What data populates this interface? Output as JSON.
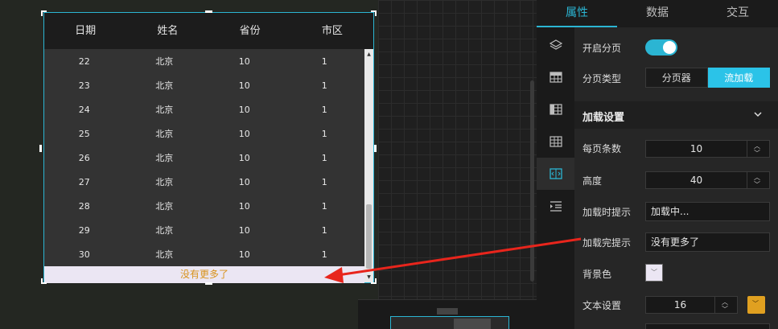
{
  "table": {
    "columns": [
      "日期",
      "姓名",
      "省份",
      "市区"
    ],
    "rows": [
      [
        "22",
        "北京",
        "10",
        "1"
      ],
      [
        "23",
        "北京",
        "10",
        "1"
      ],
      [
        "24",
        "北京",
        "10",
        "1"
      ],
      [
        "25",
        "北京",
        "10",
        "1"
      ],
      [
        "26",
        "北京",
        "10",
        "1"
      ],
      [
        "27",
        "北京",
        "10",
        "1"
      ],
      [
        "28",
        "北京",
        "10",
        "1"
      ],
      [
        "29",
        "北京",
        "10",
        "1"
      ],
      [
        "30",
        "北京",
        "10",
        "1"
      ]
    ],
    "footer_text": "没有更多了",
    "footer_bg": "#ebe6f3",
    "footer_color": "#d8931c",
    "selection_color": "#2bb5d3"
  },
  "tabs": [
    {
      "label": "属性",
      "active": true
    },
    {
      "label": "数据",
      "active": false
    },
    {
      "label": "交互",
      "active": false
    }
  ],
  "icon_bar": [
    {
      "icon": "layers-icon"
    },
    {
      "icon": "table-header-icon"
    },
    {
      "icon": "table-column-icon"
    },
    {
      "icon": "table-grid-icon"
    },
    {
      "icon": "pagination-icon",
      "active": true
    },
    {
      "icon": "indent-list-icon"
    }
  ],
  "props": {
    "pagination_label": "开启分页",
    "pagination_enabled": true,
    "pagination_type_label": "分页类型",
    "pagination_type_options": [
      "分页器",
      "流加载"
    ],
    "pagination_type_selected": "流加载",
    "load_section_title": "加载设置",
    "per_page_label": "每页条数",
    "per_page_value": "10",
    "height_label": "高度",
    "height_value": "40",
    "loading_tip_label": "加载时提示",
    "loading_tip_value": "加载中...",
    "loaded_tip_label": "加载完提示",
    "loaded_tip_value": "没有更多了",
    "bg_color_label": "背景色",
    "bg_color_value": "#ebe6f3",
    "text_settings_label": "文本设置",
    "font_size_value": "16",
    "text_color_value": "#e0a020"
  },
  "accent_color": "#2bb5d3"
}
